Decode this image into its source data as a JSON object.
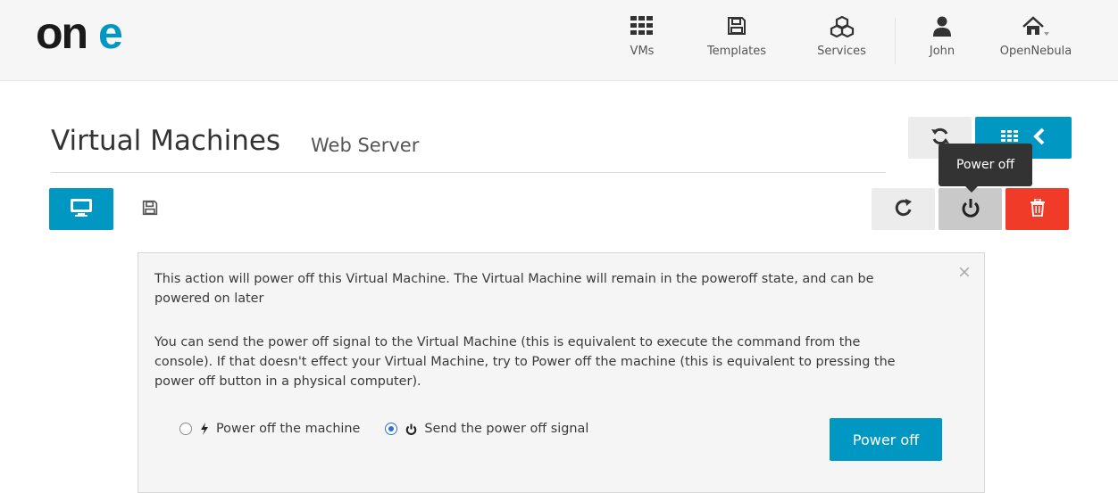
{
  "brand": {
    "logo_text": "one"
  },
  "nav": {
    "vms": "VMs",
    "templates": "Templates",
    "services": "Services",
    "user": "John",
    "zone": "OpenNebula"
  },
  "page": {
    "title": "Virtual Machines",
    "subtitle": "Web Server"
  },
  "tooltip": {
    "text": "Power off"
  },
  "dialog": {
    "paragraph1": "This action will power off this Virtual Machine. The Virtual Machine will remain in the poweroff state, and can be powered on later",
    "paragraph2": "You can send the power off signal to the Virtual Machine (this is equivalent to execute the command from the console). If that doesn't effect your Virtual Machine, try to Power off the machine (this is equivalent to pressing the power off button in a physical computer).",
    "option_hard": "Power off the machine",
    "option_signal": "Send the power off signal",
    "selected_option": "Send the power off signal",
    "submit_label": "Power off",
    "close_glyph": "×"
  },
  "colors": {
    "accent": "#0098c3",
    "danger": "#ef3b28",
    "topbar_bg": "#f6f6f6"
  },
  "icons": {
    "nav": [
      "grid-icon",
      "floppy-icon",
      "cubes-icon",
      "user-icon",
      "home-icon"
    ],
    "toolbar": [
      "refresh-icon",
      "grid-icon",
      "chevron-left-icon",
      "desktop-icon",
      "floppy-icon",
      "reload-icon",
      "power-icon",
      "trash-icon"
    ]
  }
}
